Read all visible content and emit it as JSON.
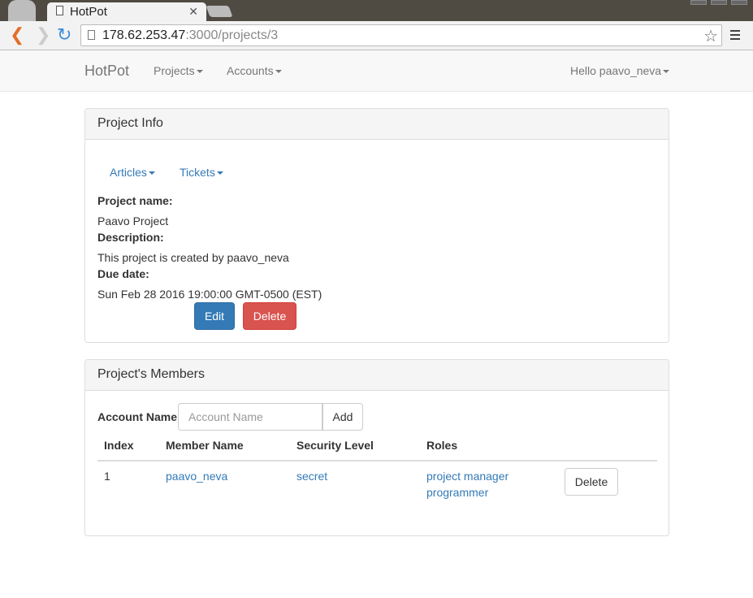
{
  "browser": {
    "tab_title": "HotPot",
    "url_host": "178.62.253.47",
    "url_rest": ":3000/projects/3"
  },
  "navbar": {
    "brand": "HotPot",
    "projects": "Projects",
    "accounts": "Accounts",
    "user": "Hello paavo_neva"
  },
  "info": {
    "title": "Project Info",
    "articles": "Articles",
    "tickets": "Tickets",
    "name_label": "Project name:",
    "name": "Paavo Project",
    "desc_label": "Description:",
    "desc": "This project is created by paavo_neva",
    "due_label": "Due date:",
    "due": "Sun Feb 28 2016 19:00:00 GMT-0500 (EST)",
    "edit": "Edit",
    "delete": "Delete"
  },
  "members": {
    "title": "Project's Members",
    "account_label": "Account Name",
    "account_placeholder": "Account Name",
    "add": "Add",
    "columns": [
      "Index",
      "Member Name",
      "Security Level",
      "Roles"
    ],
    "rows": [
      {
        "index": "1",
        "name": "paavo_neva",
        "level": "secret",
        "roles": [
          "project manager",
          "programmer"
        ],
        "delete": "Delete"
      }
    ]
  },
  "colors": {
    "primary": "#337ab7",
    "danger": "#d9534f"
  }
}
